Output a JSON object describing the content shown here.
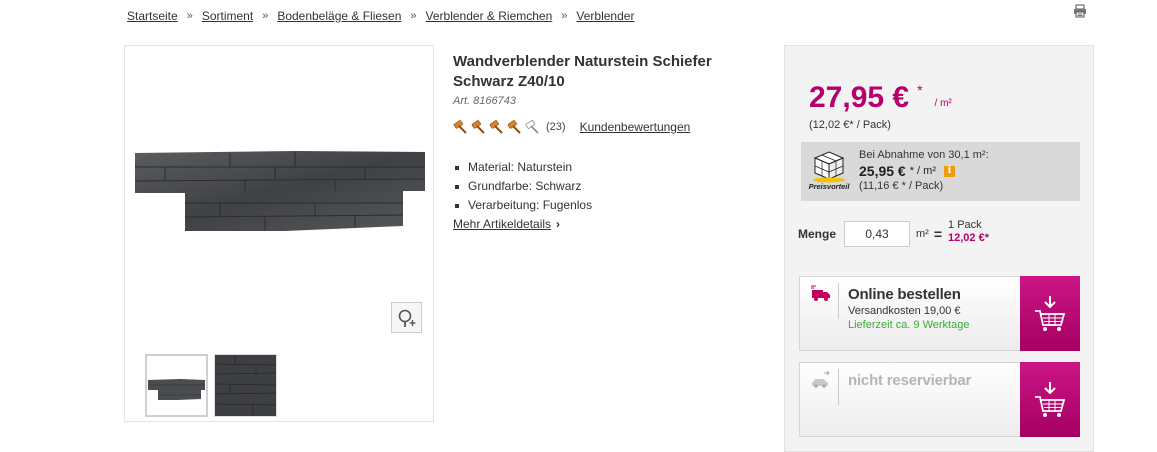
{
  "breadcrumb": {
    "items": [
      "Startseite",
      "Sortiment",
      "Bodenbeläge & Fliesen",
      "Verblender & Riemchen",
      "Verblender"
    ],
    "separator": "»"
  },
  "product": {
    "title": "Wandverblender Naturstein Schiefer Schwarz Z40/10",
    "article_number": "Art. 8166743",
    "rating": {
      "stars": 4,
      "max": 5,
      "count_text": "(23)",
      "reviews_link": "Kundenbewertungen"
    },
    "features": [
      "Material: Naturstein",
      "Grundfarbe: Schwarz",
      "Verarbeitung: Fugenlos"
    ],
    "more_details_link": "Mehr Artikeldetails"
  },
  "price": {
    "main": "27,95 €",
    "asterisk": "*",
    "unit": "/ m²",
    "pack_price": "(12,02 €*  / Pack)"
  },
  "bulk": {
    "badge": "Preisvorteil",
    "line1": "Bei Abnahme von 30,1 m²:",
    "price": "25,95 €",
    "price_suffix": "* / m²",
    "info_icon": "i",
    "pack": "(11,16 € * / Pack)"
  },
  "quantity": {
    "label": "Menge",
    "value": "0,43",
    "unit": "m²",
    "equals": "=",
    "packs": "1 Pack",
    "total": "12,02 €*"
  },
  "order_online": {
    "title": "Online bestellen",
    "shipping": "Versandkosten 19,00 €",
    "lead_time": "Lieferzeit ca. 9 Werktage"
  },
  "order_store": {
    "title": "nicht reservierbar"
  },
  "colors": {
    "accent": "#b5006e",
    "cart_button": "#b8006f",
    "lead_time": "#3fa93a",
    "rating_hammer": "#d9822b"
  }
}
